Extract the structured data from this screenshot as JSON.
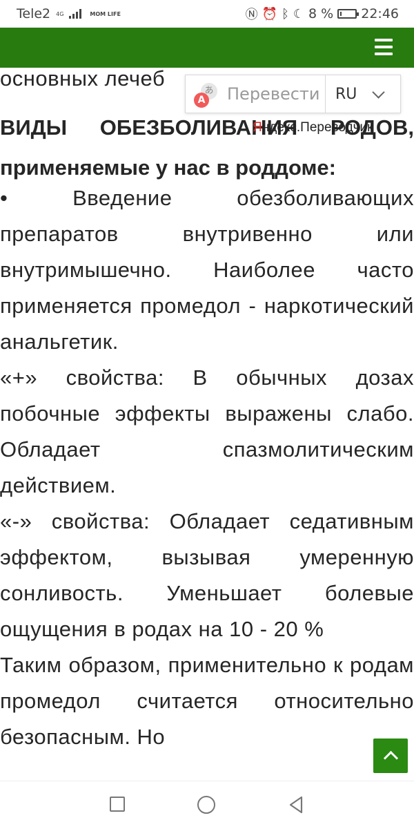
{
  "status_bar": {
    "carrier": "Tele2",
    "network_tag": "4G",
    "mom_tag": "MOM LIFE",
    "battery_text": "8 %",
    "battery_level": 0.08,
    "time": "22:46",
    "icons": [
      "nfc-icon",
      "alarm-icon",
      "bluetooth-icon",
      "moon-icon",
      "battery-icon"
    ]
  },
  "header": {
    "background": "#277b0f",
    "menu_icon": "hamburger-menu-icon"
  },
  "article": {
    "prev_line": "основных лечеб",
    "heading": "ВИДЫ ОБЕЗБОЛИВАНИЯ РОДОВ, применяемые у нас в роддоме:",
    "paragraphs": [
      "•   Введение обезболивающих препаратов внутривенно или внутримышечно. Наиболее часто применяется промедол - наркотический анальгетик.",
      "«+» свойства: В обычных дозах побочные эффекты выражены слабо. Обладает спазмолитическим действием.",
      "«-» свойства: Обладает седативным эффектом, вызывая умеренную сонливость. Уменьшает болевые ощущения в родах на 10 - 20 %",
      "Таким образом, применительно к родам промедол считается относительно безопасным. Но"
    ]
  },
  "translate_widget": {
    "label": "Перевести",
    "language": "RU",
    "brand_ya": "Я",
    "brand_rest": "ндекс.Переводчик",
    "icon_glyph": "あ",
    "icon_letter": "A"
  },
  "scroll_top": {
    "icon": "chevron-up-icon"
  },
  "nav_bar": {
    "icons": [
      "recent-apps-icon",
      "home-icon",
      "back-icon"
    ]
  }
}
